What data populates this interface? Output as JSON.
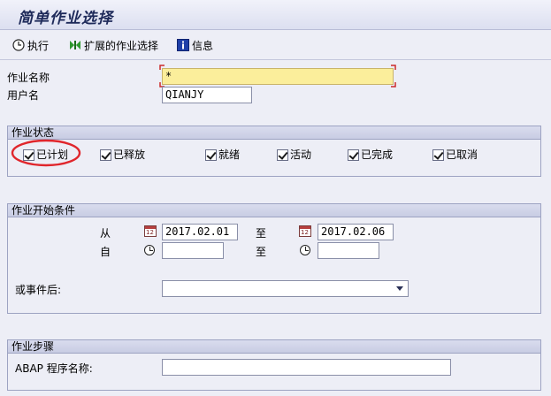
{
  "title": "简单作业选择",
  "toolbar": {
    "execute_label": "执行",
    "extended_label": "扩展的作业选择",
    "info_label": "信息"
  },
  "fields": {
    "job_name_label": "作业名称",
    "job_name_value": "*",
    "user_name_label": "用户名",
    "user_name_value": "QIANJY"
  },
  "job_status": {
    "title": "作业状态",
    "items": [
      {
        "label": "已计划",
        "checked": true
      },
      {
        "label": "已释放",
        "checked": true
      },
      {
        "label": "就绪",
        "checked": true
      },
      {
        "label": "活动",
        "checked": true
      },
      {
        "label": "已完成",
        "checked": true
      },
      {
        "label": "已取消",
        "checked": true
      }
    ]
  },
  "start_conditions": {
    "title": "作业开始条件",
    "from_label": "从",
    "to_label": "至",
    "date_from": "2017.02.01",
    "date_to": "2017.02.06",
    "time_from_label": "自",
    "time_to_label": "至",
    "time_from": "",
    "time_to": "",
    "event_label": "或事件后:",
    "event_value": ""
  },
  "job_step": {
    "title": "作业步骤",
    "program_label": "ABAP 程序名称:",
    "program_value": ""
  },
  "colors": {
    "background": "#edeef6",
    "required_field": "#fbee9b",
    "highlight_circle": "#e0262c"
  }
}
